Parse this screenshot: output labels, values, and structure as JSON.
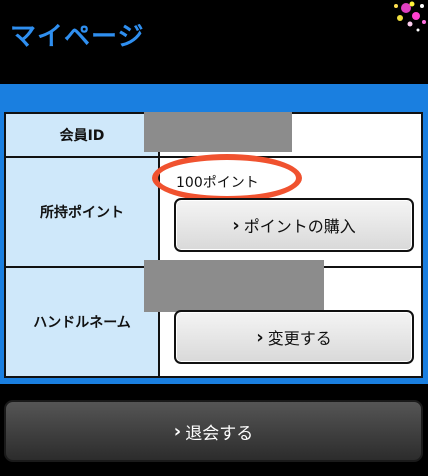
{
  "header": {
    "title": "マイページ",
    "title_color": "#2f8ff0",
    "sparkle_icon": "sparkle-icon"
  },
  "colors": {
    "band": "#1a7fe0",
    "label_bg": "#cfe8fa",
    "highlight": "#f0522f",
    "redaction": "#8c8c8c"
  },
  "profile": {
    "member_id": {
      "label": "会員ID",
      "value": ""
    },
    "points": {
      "label": "所持ポイント",
      "value": "100ポイント",
      "buy_button": {
        "chevron": "›",
        "label": "ポイントの購入"
      }
    },
    "handle_name": {
      "label": "ハンドルネーム",
      "value": "",
      "change_button": {
        "chevron": "›",
        "label": "変更する"
      }
    }
  },
  "withdraw_button": {
    "chevron": "›",
    "label": "退会する"
  }
}
